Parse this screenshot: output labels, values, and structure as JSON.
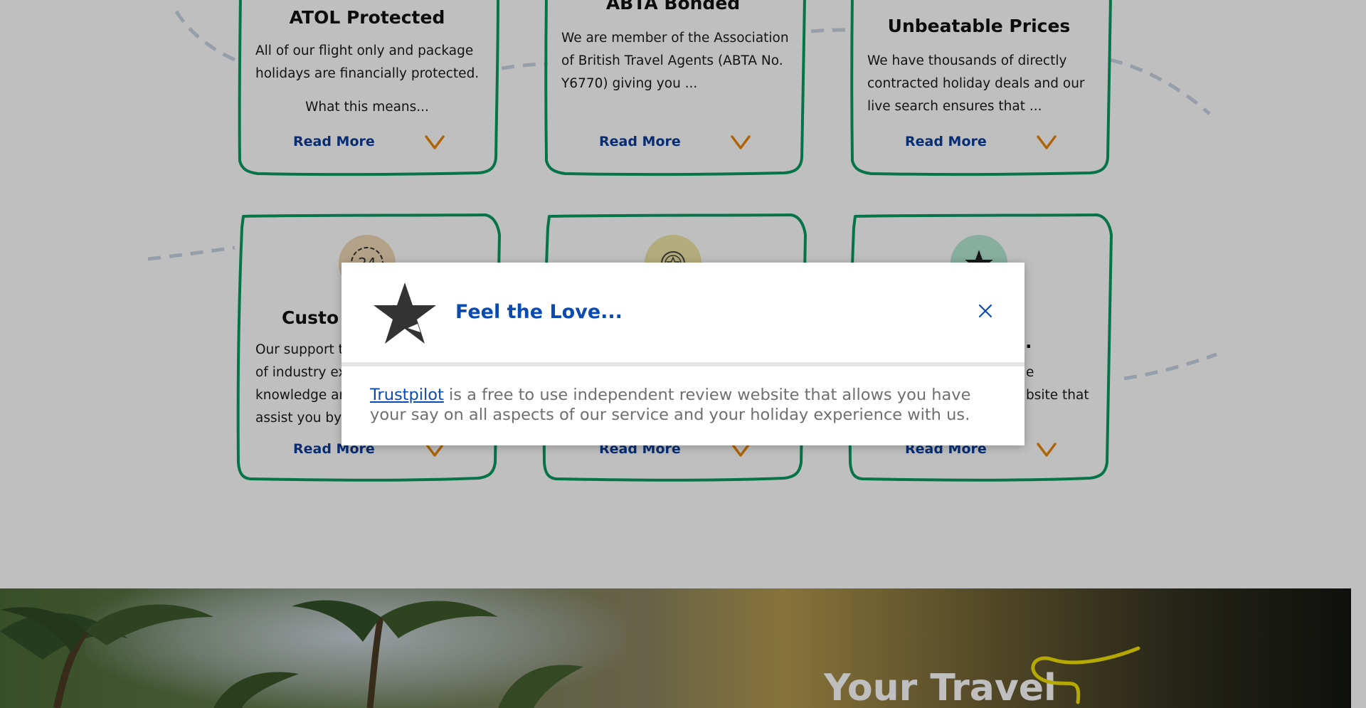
{
  "cards": [
    {
      "title": "ATOL Protected",
      "body": "All of our flight only and package holidays are financially protected.",
      "extra": "What this means...",
      "read_more": "Read More"
    },
    {
      "title": "ABTA Bonded",
      "body": "We are member of the Association of British Travel Agents (ABTA No. Y6770) giving you ...",
      "read_more": "Read More"
    },
    {
      "title": "Unbeatable Prices",
      "body": "We have thousands of directly contracted holiday deals and our live search ensures that ...",
      "read_more": "Read More"
    },
    {
      "title": "Custo",
      "badge_text": "24",
      "body": "Our support t\nof industry ex\nknowledge ar\nassist you by",
      "read_more": "Read More"
    },
    {
      "read_more": "Read More"
    },
    {
      "title": "e...",
      "body": "e\nbsite that",
      "read_more": "Read More"
    }
  ],
  "banner": {
    "title": "Your Travel"
  },
  "modal": {
    "title": "Feel the Love...",
    "link_text": "Trustpilot",
    "text": " is a free to use independent review website that allows you have your say on all aspects of our service and your holiday experience with us."
  },
  "colors": {
    "card_border": "#0a9a62",
    "link_blue": "#0a3d9a",
    "chevron_orange": "#e8860a",
    "modal_title_blue": "#0a4bb0",
    "overlay": "rgba(0,0,0,0.25)"
  },
  "icons": {
    "modal": "trustpilot-star-icon",
    "close": "close-icon",
    "chevron": "chevron-down-icon"
  }
}
